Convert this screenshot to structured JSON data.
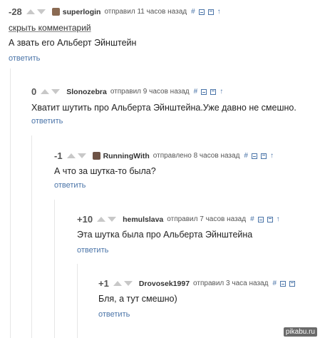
{
  "comments": [
    {
      "rating": "-28",
      "user": "superlogin",
      "meta": "отправил 11 часов назад",
      "hide": "скрыть комментарий",
      "text": "А звать его Альберт Эйнштейн",
      "reply": "ответить"
    },
    {
      "rating": "0",
      "user": "Slonozebra",
      "meta": "отправил 9 часов назад",
      "text": "Хватит шутить про Альберта Эйнштейна.Уже давно не смешно.",
      "reply": "ответить"
    },
    {
      "rating": "-1",
      "user": "RunningWith",
      "meta": "отправлено 8 часов назад",
      "text": "А что за шутка-то была?",
      "reply": "ответить"
    },
    {
      "rating": "+10",
      "user": "hemulslava",
      "meta": "отправил 7 часов назад",
      "text": "Эта шутка была про Альберта Эйнштейна",
      "reply": "ответить"
    },
    {
      "rating": "+1",
      "user": "Drovosek1997",
      "meta": "отправил 3 часа назад",
      "text": "Бля, а тут смешно)",
      "reply": "ответить"
    }
  ],
  "icons": {
    "link": "#",
    "collapse": "minus-box-icon",
    "save": "save-icon",
    "parent": "↑"
  },
  "watermark": "pikabu.ru"
}
